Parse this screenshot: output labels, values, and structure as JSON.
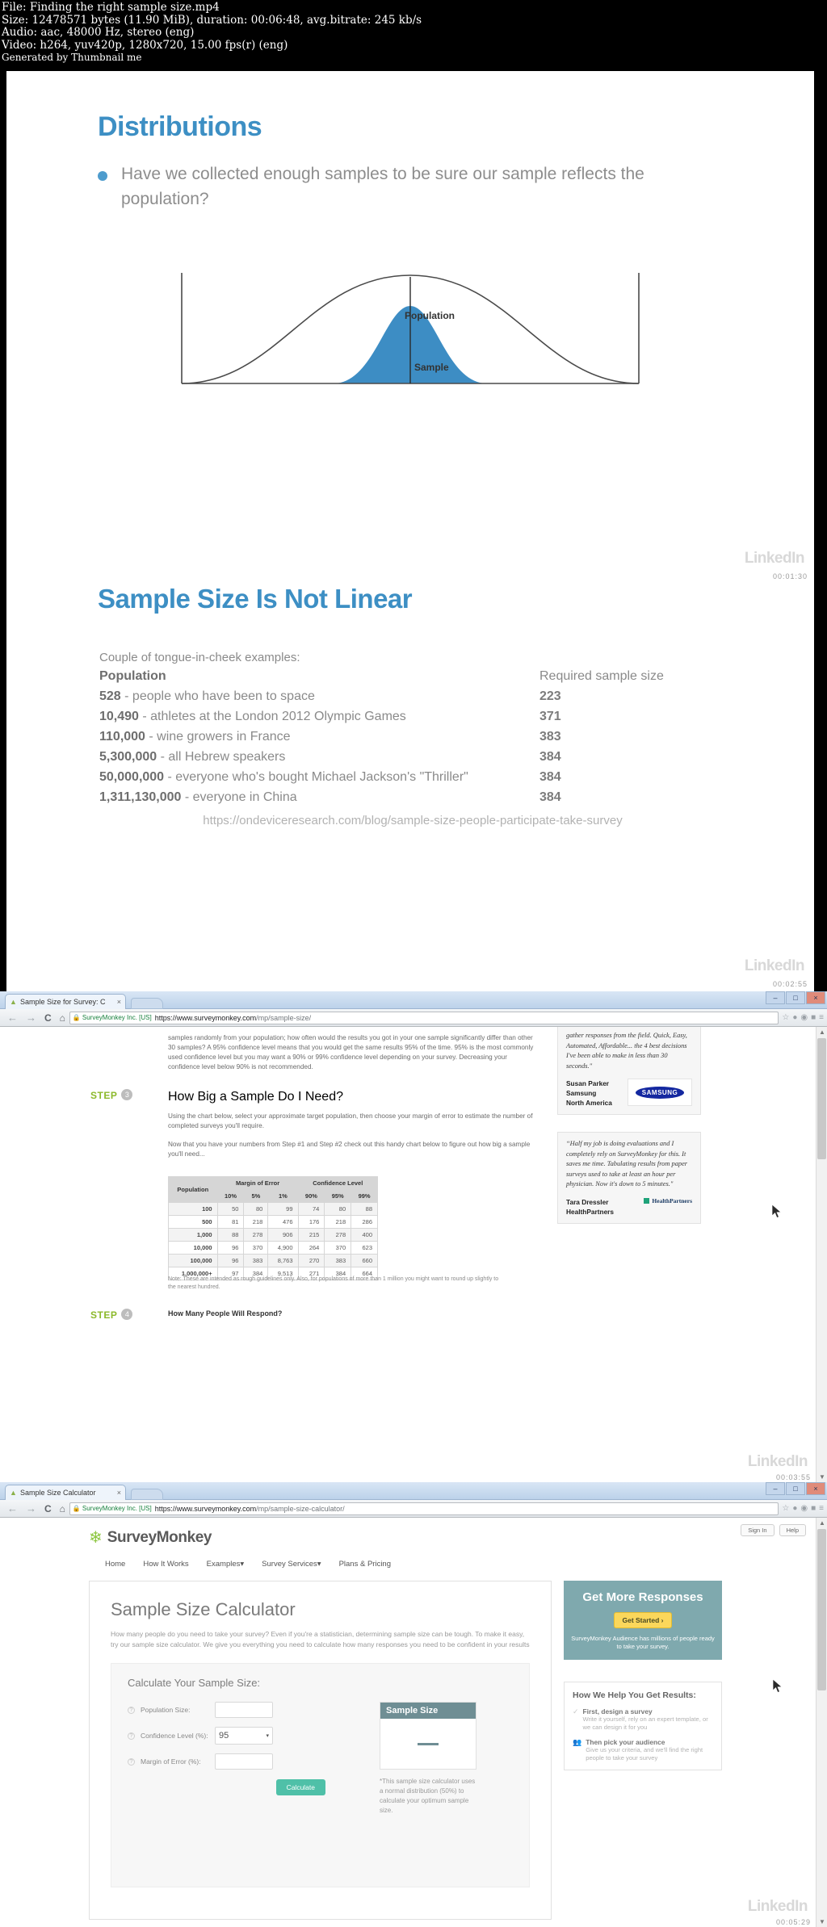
{
  "video_info": {
    "line1": "File: Finding the right sample size.mp4",
    "line2": "Size: 12478571 bytes (11.90 MiB), duration: 00:06:48, avg.bitrate: 245 kb/s",
    "line3": "Audio: aac, 48000 Hz, stereo (eng)",
    "line4": "Video: h264, yuv420p, 1280x720, 15.00 fps(r) (eng)",
    "line5": "Generated by Thumbnail me"
  },
  "slide1": {
    "title": "Distributions",
    "bullet": "Have we collected enough samples to be sure our sample reflects the population?",
    "chart_label_population": "Population",
    "chart_label_sample": "Sample",
    "badge": "LinkedIn",
    "timecode": "00:01:30"
  },
  "slide2": {
    "title": "Sample Size Is Not Linear",
    "intro": "Couple of tongue-in-cheek examples:",
    "col_population": "Population",
    "col_required": "Required sample size",
    "rows": [
      {
        "pop": "528",
        "desc": " - people who have been to space",
        "req": "223"
      },
      {
        "pop": "10,490",
        "desc": " - athletes at the London 2012 Olympic Games",
        "req": "371"
      },
      {
        "pop": "110,000",
        "desc": " - wine growers in France",
        "req": "383"
      },
      {
        "pop": "5,300,000",
        "desc": " - all Hebrew speakers",
        "req": "384"
      },
      {
        "pop": "50,000,000",
        "desc": " - everyone who's bought Michael Jackson's \"Thriller\"",
        "req": "384"
      },
      {
        "pop": "1,311,130,000",
        "desc": " - everyone in China",
        "req": "384"
      }
    ],
    "source_url": "https://ondeviceresearch.com/blog/sample-size-people-participate-take-survey",
    "badge": "LinkedIn",
    "timecode": "00:02:55"
  },
  "browser1": {
    "tab_title": "Sample Size for Survey: C",
    "tab_close": "×",
    "new_tab": "",
    "nav_back": "←",
    "nav_forward": "→",
    "nav_reload": "C",
    "nav_home": "⌂",
    "secure_label": "SurveyMonkey Inc. [US]",
    "url_secure": "https://www.surveymonkey.com",
    "url_path": "/mp/sample-size/",
    "win_min": "–",
    "win_max": "□",
    "win_close": "×",
    "article": {
      "top_paragraph": "samples randomly from your population; how often would the results you got in your one sample significantly differ than other 30 samples? A 95% confidence level means that you would get the same results 95% of the time. 95% is the most commonly used confidence level but you may want a 90% or 99% confidence level depending on your survey. Decreasing your confidence level below 90% is not recommended.",
      "step_label": "STEP",
      "step_number": "3",
      "step_heading": "How Big a Sample Do I Need?",
      "para1": "Using the chart below, select your approximate target population, then choose your margin of error to estimate the number of completed surveys you'll require.",
      "para2": "Now that you have your numbers from Step #1 and Step #2 check out this handy chart below to figure out how big a sample you'll need...",
      "note": "Note: These are intended as rough guidelines only. Also, for populations of more than 1 million you might want to round up slightly to the nearest hundred.",
      "next_step_label": "STEP",
      "next_step_number": "4",
      "next_step_heading": "How Many People Will Respond?"
    },
    "table": {
      "col_population": "Population",
      "group_margin": "Margin of Error",
      "group_confidence": "Confidence Level",
      "sub_margin": [
        "10%",
        "5%",
        "1%"
      ],
      "sub_confidence": [
        "90%",
        "95%",
        "99%"
      ],
      "rows": [
        {
          "population": "100",
          "margin": [
            "50",
            "80",
            "99"
          ],
          "confidence": [
            "74",
            "80",
            "88"
          ]
        },
        {
          "population": "500",
          "margin": [
            "81",
            "218",
            "476"
          ],
          "confidence": [
            "176",
            "218",
            "286"
          ]
        },
        {
          "population": "1,000",
          "margin": [
            "88",
            "278",
            "906"
          ],
          "confidence": [
            "215",
            "278",
            "400"
          ]
        },
        {
          "population": "10,000",
          "margin": [
            "96",
            "370",
            "4,900"
          ],
          "confidence": [
            "264",
            "370",
            "623"
          ]
        },
        {
          "population": "100,000",
          "margin": [
            "96",
            "383",
            "8,763"
          ],
          "confidence": [
            "270",
            "383",
            "660"
          ]
        },
        {
          "population": "1,000,000+",
          "margin": [
            "97",
            "384",
            "9,513"
          ],
          "confidence": [
            "271",
            "384",
            "664"
          ]
        }
      ]
    },
    "testimonial1": {
      "quote": "gather responses from the field. Quick, Easy, Automated, Affordable... the 4 best decisions I've been able to make in less than 30 seconds.\"",
      "name": "Susan Parker",
      "company": "Samsung",
      "region": "North America",
      "logo": "SAMSUNG"
    },
    "testimonial2": {
      "quote": "“Half my job is doing evaluations and I completely rely on SurveyMonkey for this. It saves me time. Tabulating results from paper surveys used to take at least an hour per physician. Now it's down to 5 minutes.\"",
      "name": "Tara Dressler",
      "company": "HealthPartners",
      "logo": "HealthPartners"
    },
    "badge": "LinkedIn",
    "timecode": "00:03:55"
  },
  "browser2": {
    "tab_title": "Sample Size Calculator",
    "tab_close": "×",
    "nav_back": "←",
    "nav_forward": "→",
    "nav_reload": "C",
    "nav_home": "⌂",
    "secure_label": "SurveyMonkey Inc. [US]",
    "url_secure": "https://www.surveymonkey.com",
    "url_path": "/mp/sample-size-calculator/",
    "win_min": "–",
    "win_max": "□",
    "win_close": "×",
    "brand": "SurveyMonkey",
    "top_buttons": [
      "Sign In",
      "Help"
    ],
    "nav_items": [
      "Home",
      "How It Works",
      "Examples",
      "Survey Services",
      "Plans & Pricing"
    ],
    "page_title": "Sample Size Calculator",
    "page_desc": "How many people do you need to take your survey? Even if you're a statistician, determining sample size can be tough. To make it easy, try our sample size calculator. We give you everything you need to calculate how many responses you need to be confident in your results",
    "calc_heading": "Calculate Your Sample Size:",
    "fields": [
      {
        "label": "Population Size:",
        "value": "",
        "type": "text"
      },
      {
        "label": "Confidence Level (%):",
        "value": "95",
        "type": "select"
      },
      {
        "label": "Margin of Error (%):",
        "value": "",
        "type": "text"
      }
    ],
    "calculate_button": "Calculate",
    "sample_size_heading": "Sample Size",
    "sample_size_value": "—",
    "calc_note": "*This sample size calculator uses a normal distribution (50%) to calculate your optimum sample size.",
    "promo": {
      "heading": "Get More Responses",
      "button": "Get Started ›",
      "text": "SurveyMonkey Audience has millions of people ready to take your survey."
    },
    "help": {
      "heading": "How We Help You Get Results:",
      "items": [
        {
          "title": "First, design a survey",
          "desc": "Write it yourself, rely on an expert template, or we can design it for you"
        },
        {
          "title": "Then pick your audience",
          "desc": "Give us your criteria, and we'll find the right people to take your survey"
        }
      ]
    },
    "badge": "LinkedIn",
    "timecode": "00:05:29"
  }
}
